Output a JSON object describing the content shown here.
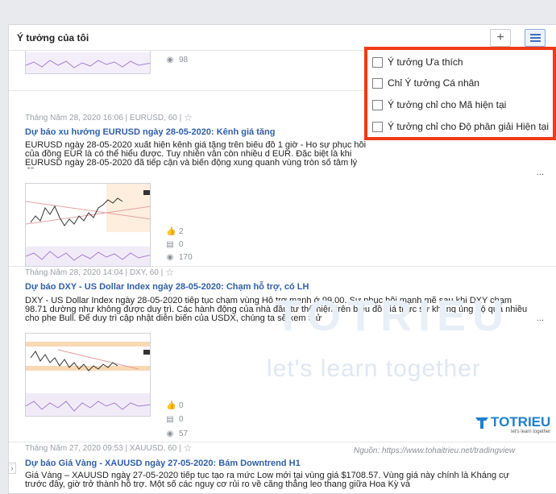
{
  "panel": {
    "title": "Ý tưởng của tôi",
    "add_icon": "plus-icon",
    "list_icon": "list-icon"
  },
  "filter_menu": {
    "items": [
      {
        "label": "Ý tưởng Ưa thích",
        "checked": false
      },
      {
        "label": "Chỉ Ý tưởng Cá nhân",
        "checked": false
      },
      {
        "label": "Ý tưởng chỉ cho Mã hiện tại",
        "checked": false
      },
      {
        "label": "Ý tưởng chỉ cho Độ phân giải Hiện tại",
        "checked": false
      }
    ]
  },
  "top_partial": {
    "views": "98"
  },
  "ideas": [
    {
      "meta": "Tháng Năm 28, 2020 16:06 | EURUSD, 60 |",
      "title": "Dự báo xu hướng EURUSD ngày 28-05-2020: Kênh giá tăng",
      "desc": "EURUSD ngày 28-05-2020 xuất hiện kênh giá tăng trên biểu đồ 1 giờ - Ho sự phục hồi của đồng EUR là có thể hiểu được. Tuy nhiên vẫn còn nhiều d EUR. Đặc biệt là khi EURUSD ngày 28-05-2020 đã tiếp cận và biến động xung quanh vùng tròn số tâm lý đặc",
      "more": "...",
      "likes": "2",
      "comments": "0",
      "views": "170"
    },
    {
      "meta": "Tháng Năm 28, 2020 14:04 | DXY, 60 |",
      "title": "Dự báo DXY - US Dollar Index ngày 28-05-2020: Chạm hỗ trợ, có LH",
      "desc": "DXY - US Dollar Index ngày 28-05-2020 tiếp tục chạm vùng Hỗ trợ mạnh ở 99.00. Sự phục hồi mạnh mẽ sau khi DXY chạm 98.71 dường như không được duy trì. Các hành động của nhà đầu tư thể hiện trên biểu đồ giá thực sự không ủng hộ quá nhiều cho phe Bull. Để duy trì cập nhật diễn biến của USDX, chúng ta sẽ xem thử",
      "more": "...",
      "likes": "0",
      "comments": "0",
      "views": "57"
    },
    {
      "meta": "Tháng Năm 27, 2020 09:53 | XAUUSD, 60 |",
      "title": "Dự báo Giá Vàng - XAUUSD ngày 27-05-2020: Bám Downtrend H1",
      "desc": "Giá Vàng – XAUUSD ngày 27-05-2020 tiếp tục tạo ra mức Low mới tại vùng giá $1708.57. Vùng giá này chính là Kháng cự trước đây, giờ trở thành hỗ trợ. Một số các nguy cơ rủi ro về căng thẳng leo thang giữa Hoa Kỳ và"
    }
  ],
  "watermark": {
    "brand": "TOTRIEU",
    "big": "TOTRIEU",
    "slogan": "let's learn together",
    "logo_sub": "let's learn together"
  },
  "source": "Nguồn: https://www.tohaitrieu.net/tradingview",
  "colors": {
    "link": "#2f5fa8",
    "highlight": "#f03a17",
    "brand": "#1e7fd0"
  }
}
